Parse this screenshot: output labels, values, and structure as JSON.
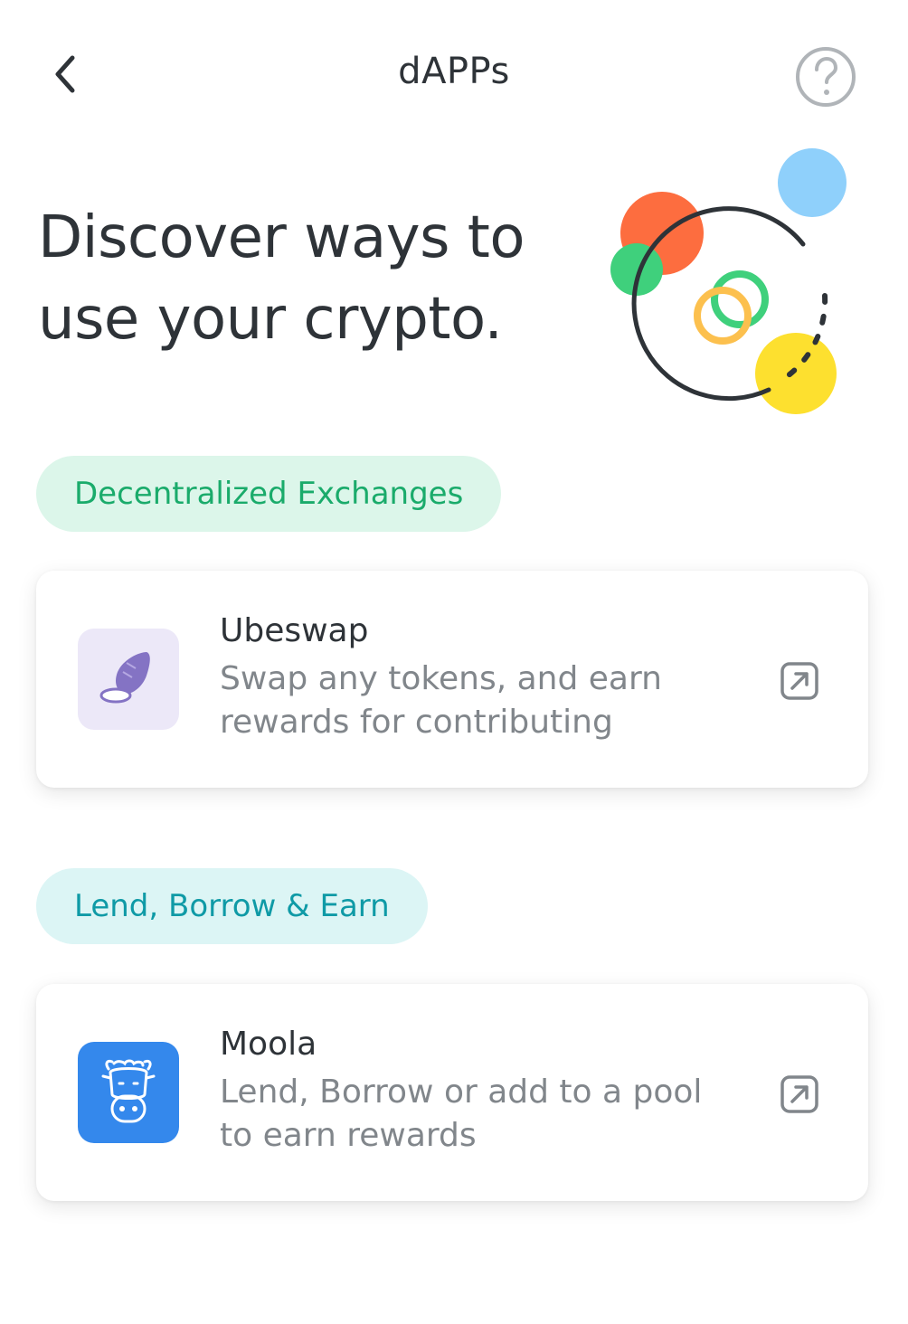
{
  "header": {
    "title": "dAPPs"
  },
  "hero": {
    "line1": "Discover ways to",
    "line2": "use your crypto."
  },
  "categories": [
    {
      "label": "Decentralized Exchanges",
      "dapps": [
        {
          "name": "Ubeswap",
          "description": "Swap any tokens, and earn rewards for contributing",
          "icon": "ubeswap-logo"
        }
      ]
    },
    {
      "label": "Lend, Borrow & Earn",
      "dapps": [
        {
          "name": "Moola",
          "description": "Lend, Borrow or add to a pool to earn rewards",
          "icon": "moola-cow-logo"
        }
      ]
    }
  ],
  "icons": {
    "back": "chevron-left-icon",
    "help": "question-circle-icon",
    "open": "external-link-icon"
  },
  "colors": {
    "dex_pill_bg": "#dcf6ea",
    "dex_pill_text": "#1aab6b",
    "lend_pill_bg": "#dcf5f5",
    "lend_pill_text": "#0f9aa6",
    "moola_blue": "#3488ec"
  }
}
